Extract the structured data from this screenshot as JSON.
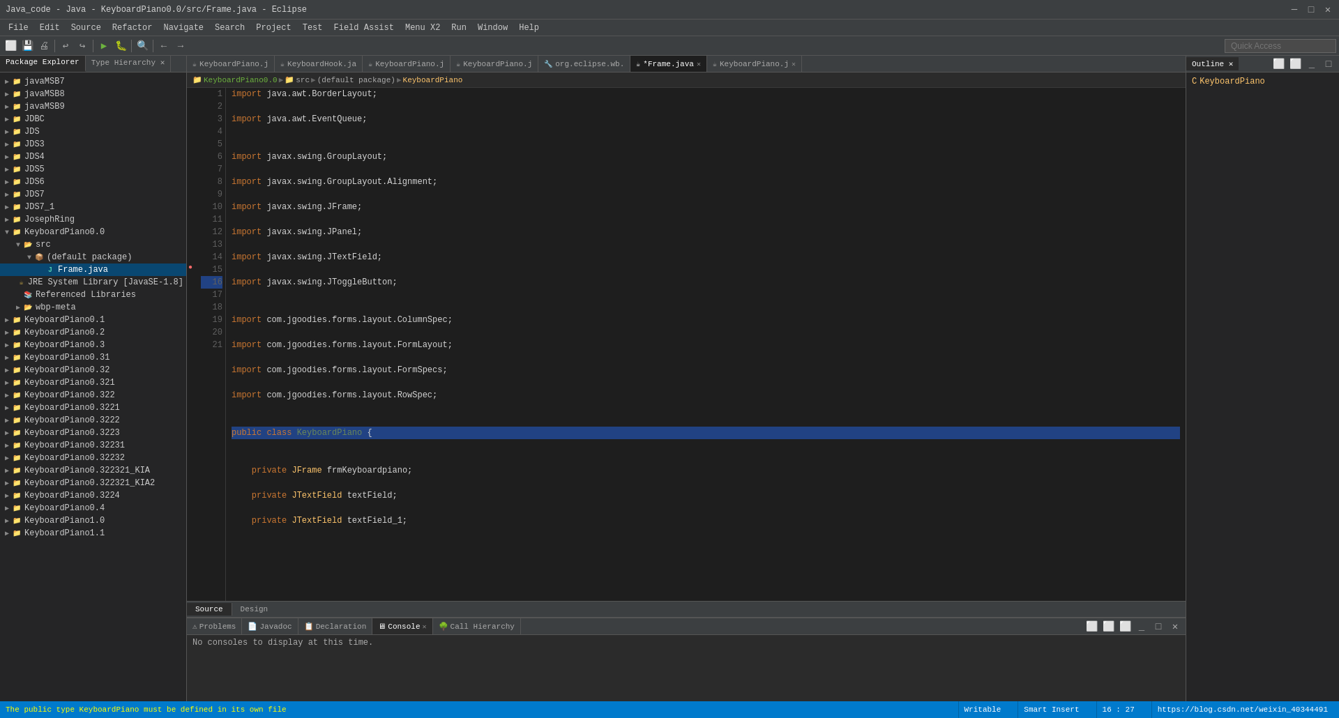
{
  "titleBar": {
    "title": "Java_code - Java - KeyboardPiano0.0/src/Frame.java - Eclipse",
    "minimize": "─",
    "maximize": "□",
    "close": "✕"
  },
  "menuBar": {
    "items": [
      "File",
      "Edit",
      "Source",
      "Refactor",
      "Navigate",
      "Search",
      "Project",
      "Test",
      "Field Assist",
      "Menu X2",
      "Run",
      "Window",
      "Help"
    ]
  },
  "toolbar": {
    "quickAccess": "Quick Access"
  },
  "leftPanel": {
    "tabs": [
      "Package Explorer",
      "Type Hierarchy"
    ],
    "activeTab": "Package Explorer"
  },
  "tree": {
    "items": [
      {
        "label": "javaMSB7",
        "level": 0,
        "type": "project",
        "expanded": false
      },
      {
        "label": "javaMSB8",
        "level": 0,
        "type": "project",
        "expanded": false
      },
      {
        "label": "javaMSB9",
        "level": 0,
        "type": "project",
        "expanded": false
      },
      {
        "label": "JDBC",
        "level": 0,
        "type": "project",
        "expanded": false
      },
      {
        "label": "JDS",
        "level": 0,
        "type": "project",
        "expanded": false
      },
      {
        "label": "JDS3",
        "level": 0,
        "type": "project",
        "expanded": false
      },
      {
        "label": "JDS4",
        "level": 0,
        "type": "project",
        "expanded": false
      },
      {
        "label": "JDS5",
        "level": 0,
        "type": "project",
        "expanded": false
      },
      {
        "label": "JDS6",
        "level": 0,
        "type": "project",
        "expanded": false
      },
      {
        "label": "JDS7",
        "level": 0,
        "type": "project",
        "expanded": false
      },
      {
        "label": "JDS7_1",
        "level": 0,
        "type": "project",
        "expanded": false
      },
      {
        "label": "JosephRing",
        "level": 0,
        "type": "project",
        "expanded": false
      },
      {
        "label": "KeyboardPiano0.0",
        "level": 0,
        "type": "project",
        "expanded": true
      },
      {
        "label": "src",
        "level": 1,
        "type": "folder",
        "expanded": true
      },
      {
        "label": "(default package)",
        "level": 2,
        "type": "package",
        "expanded": true
      },
      {
        "label": "Frame.java",
        "level": 3,
        "type": "java",
        "expanded": false,
        "selected": true
      },
      {
        "label": "JRE System Library [JavaSE-1.8]",
        "level": 1,
        "type": "jar",
        "expanded": false
      },
      {
        "label": "Referenced Libraries",
        "level": 1,
        "type": "ref",
        "expanded": false
      },
      {
        "label": "wbp-meta",
        "level": 1,
        "type": "folder",
        "expanded": false
      },
      {
        "label": "KeyboardPiano0.1",
        "level": 0,
        "type": "project",
        "expanded": false
      },
      {
        "label": "KeyboardPiano0.2",
        "level": 0,
        "type": "project",
        "expanded": false
      },
      {
        "label": "KeyboardPiano0.3",
        "level": 0,
        "type": "project",
        "expanded": false
      },
      {
        "label": "KeyboardPiano0.31",
        "level": 0,
        "type": "project",
        "expanded": false
      },
      {
        "label": "KeyboardPiano0.32",
        "level": 0,
        "type": "project",
        "expanded": false
      },
      {
        "label": "KeyboardPiano0.321",
        "level": 0,
        "type": "project",
        "expanded": false
      },
      {
        "label": "KeyboardPiano0.322",
        "level": 0,
        "type": "project",
        "expanded": false
      },
      {
        "label": "KeyboardPiano0.3221",
        "level": 0,
        "type": "project",
        "expanded": false
      },
      {
        "label": "KeyboardPiano0.3222",
        "level": 0,
        "type": "project",
        "expanded": false
      },
      {
        "label": "KeyboardPiano0.3223",
        "level": 0,
        "type": "project",
        "expanded": false
      },
      {
        "label": "KeyboardPiano0.32231",
        "level": 0,
        "type": "project",
        "expanded": false
      },
      {
        "label": "KeyboardPiano0.32232",
        "level": 0,
        "type": "project",
        "expanded": false
      },
      {
        "label": "KeyboardPiano0.322321_KIA",
        "level": 0,
        "type": "project",
        "expanded": false
      },
      {
        "label": "KeyboardPiano0.322321_KIA2",
        "level": 0,
        "type": "project",
        "expanded": false
      },
      {
        "label": "KeyboardPiano0.3224",
        "level": 0,
        "type": "project",
        "expanded": false
      },
      {
        "label": "KeyboardPiano0.4",
        "level": 0,
        "type": "project",
        "expanded": false
      },
      {
        "label": "KeyboardPiano1.0",
        "level": 0,
        "type": "project",
        "expanded": false
      },
      {
        "label": "KeyboardPiano1.1",
        "level": 0,
        "type": "project",
        "expanded": false
      }
    ]
  },
  "editorTabs": [
    {
      "label": "KeyboardPiano.j",
      "active": false,
      "modified": false
    },
    {
      "label": "KeyboardHook.ja",
      "active": false,
      "modified": false
    },
    {
      "label": "KeyboardPiano.j",
      "active": false,
      "modified": false
    },
    {
      "label": "KeyboardPiano.j",
      "active": false,
      "modified": false
    },
    {
      "label": "org.eclipse.wb.",
      "active": false,
      "modified": false
    },
    {
      "label": "*Frame.java",
      "active": true,
      "modified": true
    },
    {
      "label": "KeyboardPiano.j",
      "active": false,
      "modified": false
    }
  ],
  "breadcrumb": {
    "parts": [
      "KeyboardPiano0.0",
      "src",
      "(default package)",
      "KeyboardPiano"
    ]
  },
  "code": {
    "lines": [
      {
        "num": 1,
        "content": "import java.awt.BorderLayout;",
        "highlight": false
      },
      {
        "num": 2,
        "content": "import java.awt.EventQueue;",
        "highlight": false
      },
      {
        "num": 3,
        "content": "",
        "highlight": false
      },
      {
        "num": 4,
        "content": "import javax.swing.GroupLayout;",
        "highlight": false
      },
      {
        "num": 5,
        "content": "import javax.swing.GroupLayout.Alignment;",
        "highlight": false
      },
      {
        "num": 6,
        "content": "import javax.swing.JFrame;",
        "highlight": false
      },
      {
        "num": 7,
        "content": "import javax.swing.JPanel;",
        "highlight": false
      },
      {
        "num": 8,
        "content": "import javax.swing.JTextField;",
        "highlight": false
      },
      {
        "num": 9,
        "content": "import javax.swing.JToggleButton;",
        "highlight": false
      },
      {
        "num": 10,
        "content": "",
        "highlight": false
      },
      {
        "num": 11,
        "content": "import com.jgoodies.forms.layout.ColumnSpec;",
        "highlight": false
      },
      {
        "num": 12,
        "content": "import com.jgoodies.forms.layout.FormLayout;",
        "highlight": false
      },
      {
        "num": 13,
        "content": "import com.jgoodies.forms.layout.FormSpecs;",
        "highlight": false
      },
      {
        "num": 14,
        "content": "import com.jgoodies.forms.layout.RowSpec;",
        "highlight": false
      },
      {
        "num": 15,
        "content": "",
        "highlight": false
      },
      {
        "num": 16,
        "content": "public class KeyboardPiano {",
        "highlight": true
      },
      {
        "num": 17,
        "content": "",
        "highlight": false
      },
      {
        "num": 18,
        "content": "    private JFrame frmKeyboardpiano;",
        "highlight": false
      },
      {
        "num": 19,
        "content": "    private JTextField textField;",
        "highlight": false
      },
      {
        "num": 20,
        "content": "    private JTextField textField_1;",
        "highlight": false
      },
      {
        "num": 21,
        "content": "",
        "highlight": false
      }
    ]
  },
  "editorTabs2": {
    "source": "Source",
    "design": "Design"
  },
  "bottomPanel": {
    "tabs": [
      "Problems",
      "Javadoc",
      "Declaration",
      "Console",
      "Call Hierarchy"
    ],
    "activeTab": "Console",
    "consoleMsg": "No consoles to display at this time."
  },
  "rightPanel": {
    "tab": "Outline",
    "items": [
      "KeyboardPiano"
    ]
  },
  "statusBar": {
    "message": "The public type KeyboardPiano must be defined in its own file",
    "writable": "Writable",
    "smartInsert": "Smart Insert",
    "position": "16 : 27",
    "url": "https://blog.csdn.net/weixin_40344491"
  }
}
